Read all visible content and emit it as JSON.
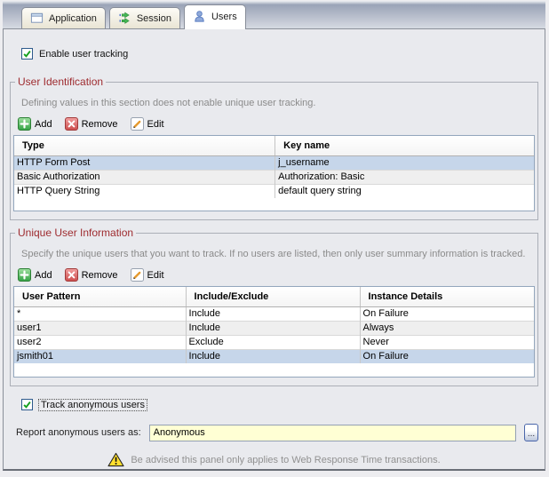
{
  "tabs": [
    {
      "label": "Application",
      "active": false
    },
    {
      "label": "Session",
      "active": false
    },
    {
      "label": "Users",
      "active": true
    }
  ],
  "enable_tracking_label": "Enable user tracking",
  "user_identification": {
    "title": "User Identification",
    "description": "Defining values in this section does not enable unique user tracking.",
    "toolbar": {
      "add": "Add",
      "remove": "Remove",
      "edit": "Edit"
    },
    "table": {
      "columns": [
        "Type",
        "Key name"
      ],
      "col_widths": [
        "50.2%",
        "49.8%"
      ],
      "rows": [
        {
          "cells": [
            "HTTP Form Post",
            "j_username"
          ],
          "selected": true
        },
        {
          "cells": [
            "Basic Authorization",
            "Authorization: Basic"
          ],
          "selected": false
        },
        {
          "cells": [
            "HTTP Query String",
            "default query string"
          ],
          "selected": false
        }
      ]
    }
  },
  "unique_user_information": {
    "title": "Unique User Information",
    "description": "Specify the unique users that you want to track. If no users are listed, then only user summary information is tracked.",
    "toolbar": {
      "add": "Add",
      "remove": "Remove",
      "edit": "Edit"
    },
    "table": {
      "columns": [
        "User Pattern",
        "Include/Exclude",
        "Instance Details"
      ],
      "col_widths": [
        "33%",
        "33.5%",
        "33.5%"
      ],
      "rows": [
        {
          "cells": [
            "*",
            "Include",
            "On Failure"
          ],
          "selected": false
        },
        {
          "cells": [
            "user1",
            "Include",
            "Always"
          ],
          "selected": false
        },
        {
          "cells": [
            "user2",
            "Exclude",
            "Never"
          ],
          "selected": false
        },
        {
          "cells": [
            "jsmith01",
            "Include",
            "On Failure"
          ],
          "selected": true
        }
      ]
    }
  },
  "track_anonymous_label": "Track anonymous users",
  "report_anonymous": {
    "label": "Report anonymous users as:",
    "value": "Anonymous",
    "browse_label": "..."
  },
  "warning_text": "Be advised this panel only applies to Web Response Time transactions.",
  "colors": {
    "group_title": "#9e2b2f",
    "selected_row": "#c6d6ea",
    "input_bg": "#ffffd4",
    "add_green": "#3fae4f",
    "remove_red": "#cc4c4c",
    "warning_yellow": "#ffdf2e",
    "check_green": "#15a01e"
  }
}
